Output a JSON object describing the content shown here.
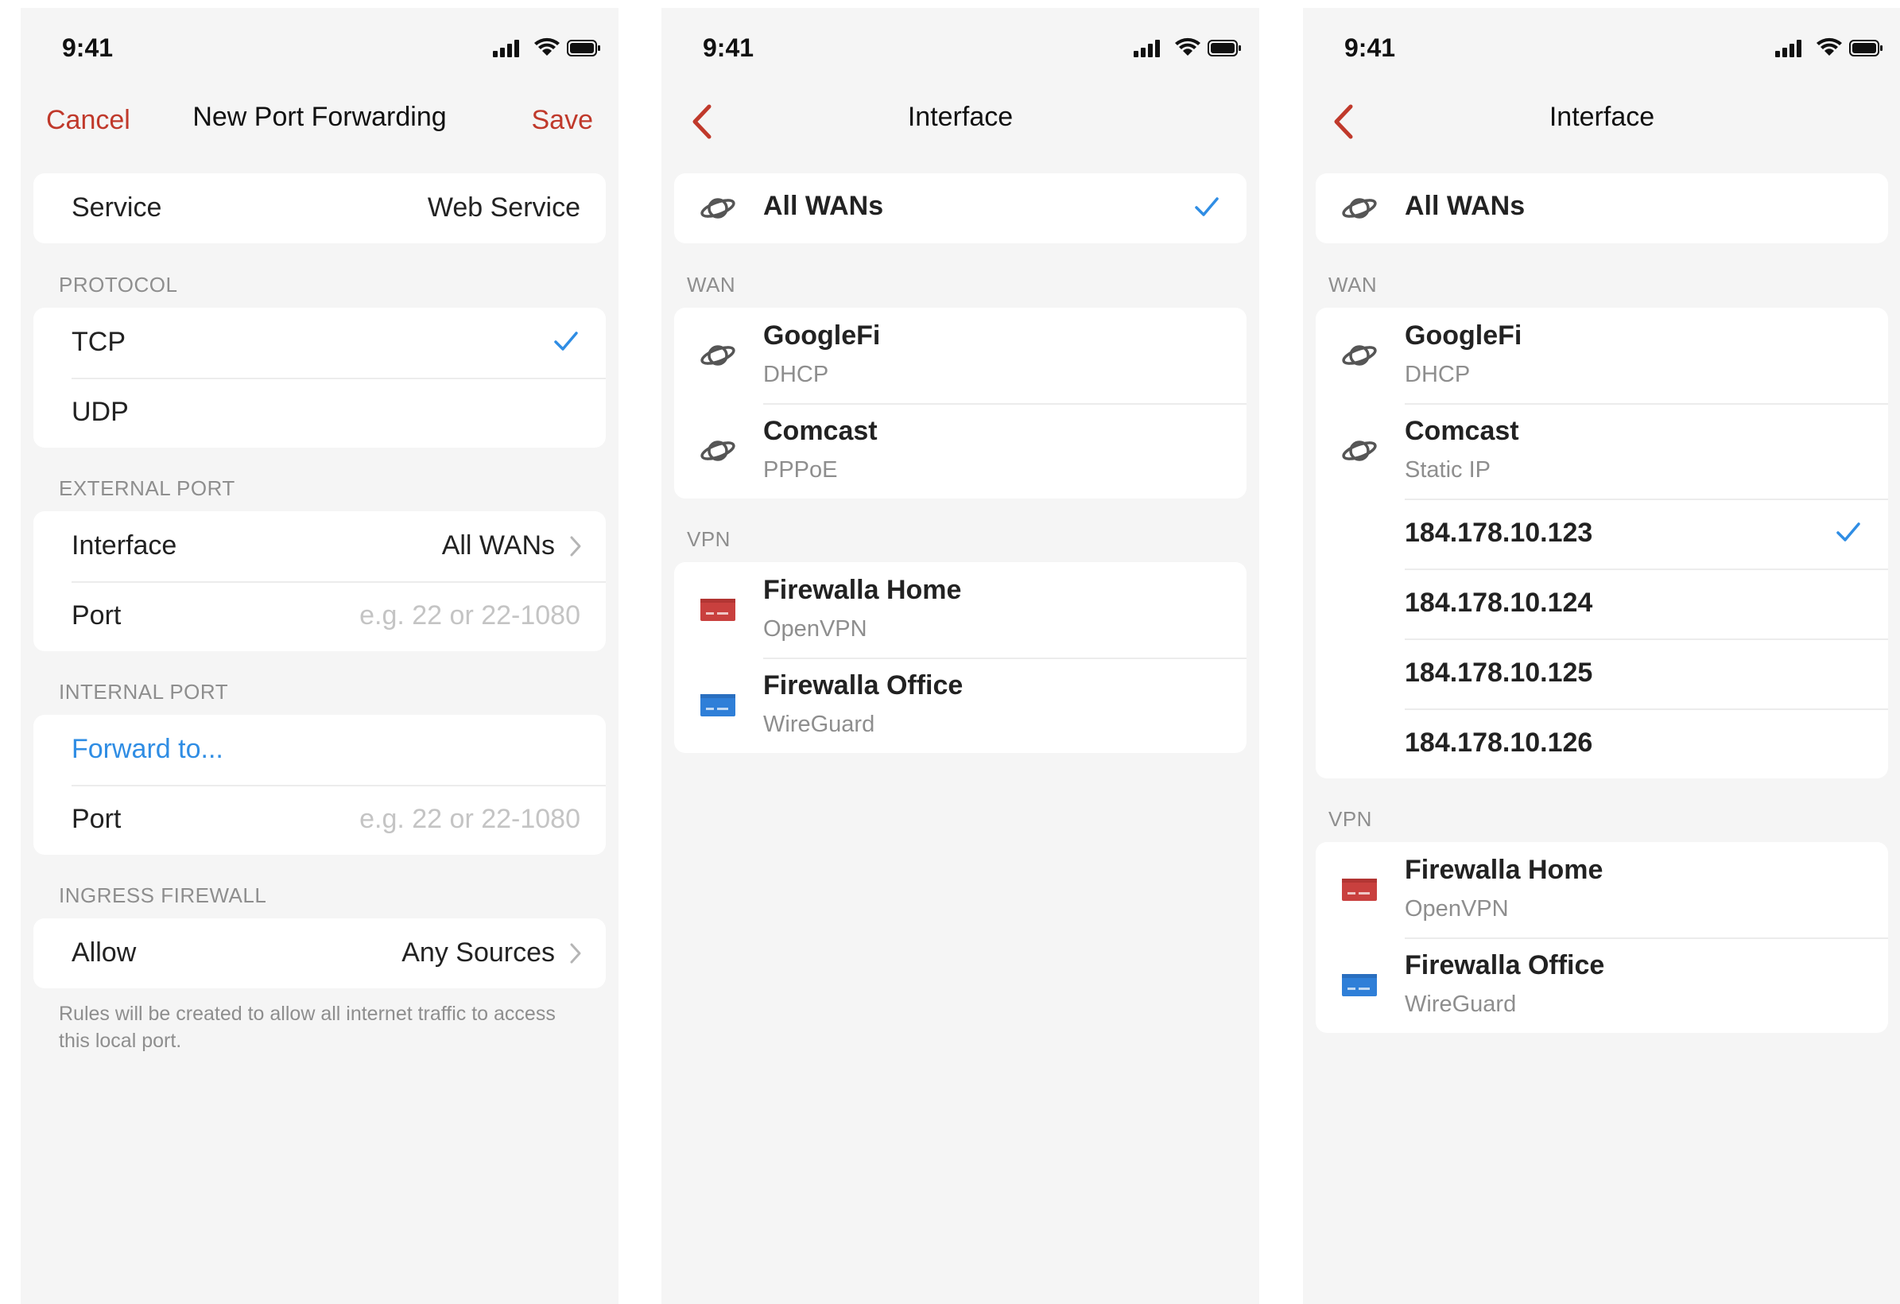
{
  "status": {
    "time": "9:41"
  },
  "screen1": {
    "nav": {
      "cancel": "Cancel",
      "title": "New Port Forwarding",
      "save": "Save"
    },
    "service": {
      "label": "Service",
      "value": "Web Service"
    },
    "protocol": {
      "header": "PROTOCOL",
      "options": [
        "TCP",
        "UDP"
      ],
      "selected": "TCP"
    },
    "external_port": {
      "header": "EXTERNAL PORT",
      "interface_label": "Interface",
      "interface_value": "All WANs",
      "port_label": "Port",
      "port_placeholder": "e.g. 22 or 22-1080"
    },
    "internal_port": {
      "header": "INTERNAL PORT",
      "forward_to": "Forward to...",
      "port_label": "Port",
      "port_placeholder": "e.g. 22 or 22-1080"
    },
    "ingress": {
      "header": "INGRESS FIREWALL",
      "allow_label": "Allow",
      "allow_value": "Any Sources",
      "footnote": "Rules will be created to allow all internet traffic to access this local port."
    }
  },
  "screen2": {
    "nav": {
      "title": "Interface"
    },
    "all_wans": "All WANs",
    "wan_header": "WAN",
    "wans": [
      {
        "name": "GoogleFi",
        "type": "DHCP"
      },
      {
        "name": "Comcast",
        "type": "PPPoE"
      }
    ],
    "vpn_header": "VPN",
    "vpns": [
      {
        "name": "Firewalla Home",
        "type": "OpenVPN",
        "icon": "firewalla-red-device-icon"
      },
      {
        "name": "Firewalla Office",
        "type": "WireGuard",
        "icon": "firewalla-blue-device-icon"
      }
    ],
    "selected": "All WANs"
  },
  "screen3": {
    "nav": {
      "title": "Interface"
    },
    "all_wans": "All WANs",
    "wan_header": "WAN",
    "wans": [
      {
        "name": "GoogleFi",
        "type": "DHCP"
      },
      {
        "name": "Comcast",
        "type": "Static IP"
      }
    ],
    "ips": [
      "184.178.10.123",
      "184.178.10.124",
      "184.178.10.125",
      "184.178.10.126"
    ],
    "selected_ip": "184.178.10.123",
    "vpn_header": "VPN",
    "vpns": [
      {
        "name": "Firewalla Home",
        "type": "OpenVPN",
        "icon": "firewalla-red-device-icon"
      },
      {
        "name": "Firewalla Office",
        "type": "WireGuard",
        "icon": "firewalla-blue-device-icon"
      }
    ]
  },
  "colors": {
    "accent_red": "#c0392b",
    "check_blue": "#2f8de4",
    "link_blue": "#2f8de4",
    "vpn_red": "#c9403e",
    "vpn_blue": "#2f7fd8"
  }
}
